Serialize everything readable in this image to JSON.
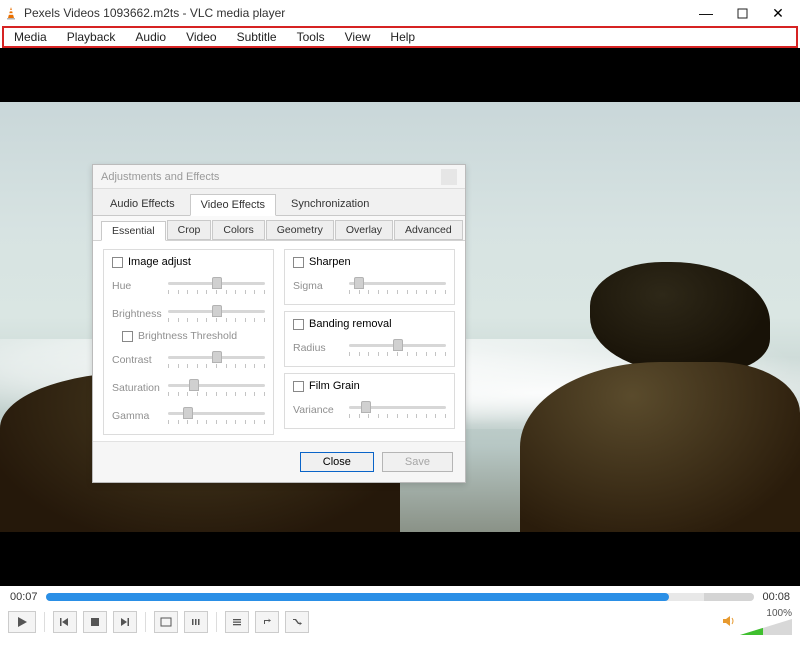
{
  "window": {
    "title": "Pexels Videos 1093662.m2ts - VLC media player"
  },
  "menu": [
    "Media",
    "Playback",
    "Audio",
    "Video",
    "Subtitle",
    "Tools",
    "View",
    "Help"
  ],
  "dialog": {
    "title": "Adjustments and Effects",
    "mainTabs": [
      "Audio Effects",
      "Video Effects",
      "Synchronization"
    ],
    "subTabs": [
      "Essential",
      "Crop",
      "Colors",
      "Geometry",
      "Overlay",
      "Advanced"
    ],
    "left": {
      "checkbox": "Image adjust",
      "sliders": [
        {
          "label": "Hue",
          "pos": 0.45
        },
        {
          "label": "Brightness",
          "pos": 0.45
        },
        {
          "label": "Contrast",
          "pos": 0.45
        },
        {
          "label": "Saturation",
          "pos": 0.22
        },
        {
          "label": "Gamma",
          "pos": 0.15
        }
      ],
      "brightnessThreshold": "Brightness Threshold"
    },
    "right": [
      {
        "checkbox": "Sharpen",
        "label": "Sigma",
        "pos": 0.05
      },
      {
        "checkbox": "Banding removal",
        "label": "Radius",
        "pos": 0.45
      },
      {
        "checkbox": "Film Grain",
        "label": "Variance",
        "pos": 0.12
      }
    ],
    "close": "Close",
    "save": "Save"
  },
  "player": {
    "current": "00:07",
    "total": "00:08",
    "progress": 0.88,
    "volume": "100%"
  }
}
